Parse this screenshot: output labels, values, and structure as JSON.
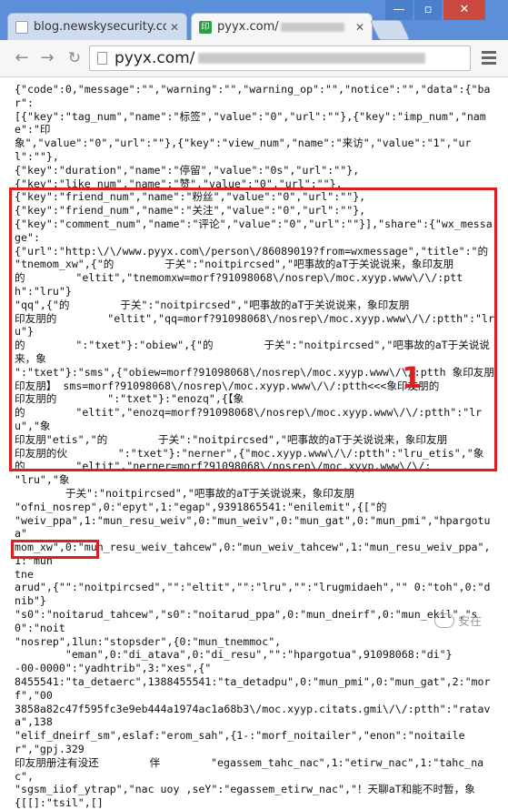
{
  "browser": {
    "tabs": [
      {
        "title": "blog.newskysecurity.cor",
        "active": false
      },
      {
        "title": "pyyx.com/",
        "favicon_text": "印",
        "active": true
      }
    ],
    "address_bar": {
      "url": "pyyx.com/"
    },
    "colors": {
      "frame": "#5b8fd9",
      "close_button": "#c9483f",
      "favicon": "#2e9e45"
    }
  },
  "page": {
    "lines": [
      "{\"code\":0,\"message\":\"\",\"warning\":\"\",\"warning_op\":\"\",\"notice\":\"\",\"data\":{\"bar\":",
      "[{\"key\":\"tag_num\",\"name\":\"标签\",\"value\":\"0\",\"url\":\"\"},{\"key\":\"imp_num\",\"name\":\"印",
      "象\",\"value\":\"0\",\"url\":\"\"},{\"key\":\"view_num\",\"name\":\"来访\",\"value\":\"1\",\"url\":\"\"},",
      "{\"key\":\"duration\",\"name\":\"停留\",\"value\":\"0s\",\"url\":\"\"},",
      "{\"key\":\"like_num\",\"name\":\"赞\",\"value\":\"0\",\"url\":\"\"},",
      "{\"key\":\"friend_num\",\"name\":\"粉丝\",\"value\":\"0\",\"url\":\"\"},",
      "{\"key\":\"friend_num\",\"name\":\"关注\",\"value\":\"0\",\"url\":\"\"},",
      "{\"key\":\"comment_num\",\"name\":\"评论\",\"value\":\"0\",\"url\":\"\"}],\"share\":{\"wx_message\":",
      "{\"url\":\"http:\\/\\/www.pyyx.com\\/person\\/86089019?from=wxmessage\",\"title\":\"的",
      "\"tnemom_xw\",{\"的        于关\":\"noitpircsed\",\"吧事故的aT于关说说来，象印友朋",
      "的        \"eltit\",\"tnemomxw=morf?91098068\\/nosrep\\/moc.xyyp.www\\/\\/:ptth\":\"lru\"}",
      "\"qq\",{\"的        于关\":\"noitpircsed\",\"吧事故的aT于关说说来，象印友朋",
      "印友朋的        \"eltit\",\"qq=morf?91098068\\/nosrep\\/moc.xyyp.www\\/\\/:ptth\":\"lru\"}",
      "的        \":\"txet\"}:\"obiew\",{\"的        于关\":\"noitpircsed\",\"吧事故的aT于关说说来，象",
      "\":\"txet\"}:\"sms\",{\"obiew=morf?91098068\\/nosrep\\/moc.xyyp.www\\/\\/:ptth 象印友朋",
      "印友朋】 sms=morf?91098068\\/nosrep\\/moc.xyyp.www\\/\\/:ptth<<<象印友朋的",
      "印友朋的        \":\"txet\"}:\"enozq\",{【象",
      "的        \"eltit\",\"enozq=morf?91098068\\/nosrep\\/moc.xyyp.www\\/\\/:ptth\":\"lru\",\"象",
      "印友朋\"etis\",\"的        于关\":\"noitpircsed\",\"吧事故的aT于关说说来，象印友朋",
      "印友朋的伙        \":\"txet\"}:\"nerner\",{\"moc.xyyp.www\\/\\/:ptth\":\"lru_etis\",\"象",
      "的        \"eltit\",\"nerner=morf?91098068\\/nosrep\\/moc.xyyp.www\\/\\/:        \"lru\",\"象",
      "        于关\":\"noitpircsed\",\"吧事故的aT于关说说来，象印友朋",
      "\"ofni_nosrep\",0:\"epyt\",1:\"egap\",9391865541:\"enilemit\",{[\"的",
      "\"weiv_ppa\",1:\"mun_resu_weiv\",0:\"mun_weiv\",0:\"mun_gat\",0:\"mun_pmi\",\"hpargotua\"",
      "mom_xw\",0:\"mun_resu_weiv_tahcew\",0:\"mun_weiv_tahcew\",1:\"mun_resu_weiv_ppa\",1:\"mun",
      "tne",
      "arud\",{\"\":\"noitpircsed\",\"\":\"eltit\",\"\":\"lru\",\"\":\"lrugmidaeh\",\"\" 0:\"toh\",0:\"dnib\"}",
      "\"s0\":\"noitarud_tahcew\",\"s0\":\"noitarud_ppa\",0:\"mun_dneirf\",0:\"mun_ekil\",\"s0\":\"noit",
      "\"nosrep\",1lun:\"stopsder\",{0:\"mun_tnemmoc\",",
      "        \"eman\",0:\"di_atava\",0:\"di_resu\",\"\":\"hpargotua\",91098068:\"di\"}",
      "-00-0000\":\"yadhtrib\",3:\"xes\",{\"",
      "8455541:\"ta_detaerc\",1388455541:\"ta_detadpu\",0:\"mun_pmi\",0:\"mun_gat\",2:\"morf\",\"00",
      "3858a82c47f595fc3e9eb444a1974ac1a68b3\\/moc.xyyp.citats.gmi\\/\\/:ptth\":\"ratava\",138",
      "\"elif_dneirf_sm\",eslaf:\"erom_sah\",{1-:\"morf_noitailer\",\"enon\":\"noitailer\",\"gpj.329",
      "印友朋册注有没还        伴        \"egassem_tahc_nac\",1:\"etirw_nac\",1:\"tahc_nac\",",
      "\"sgsm_iiof_ytrap\",\"nac uoy ,seY\":\"egassem_etirw_nac\",\"！天聊aT和能不时暂，象",
      "{[[]:\"tsil\",[]"
    ],
    "highlight_label": "1",
    "watermark_text": "安在"
  }
}
